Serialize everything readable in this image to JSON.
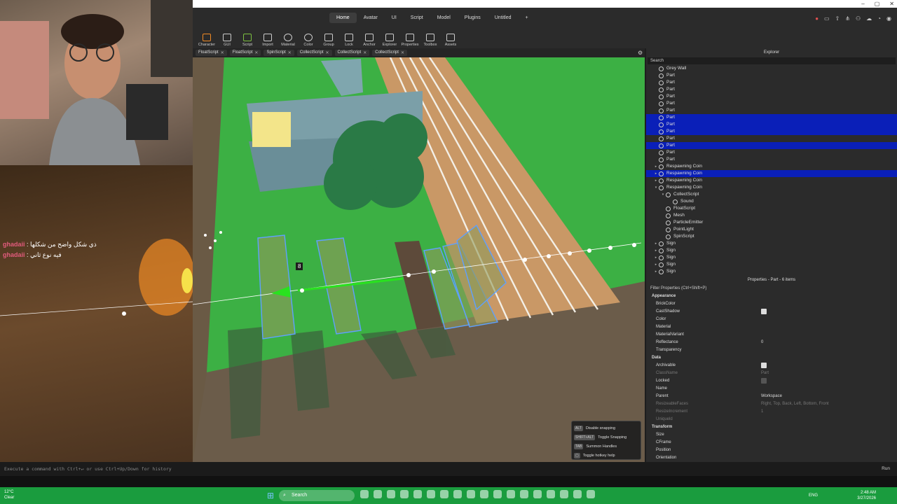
{
  "window": {
    "min": "–",
    "max": "▢",
    "close": "✕"
  },
  "menu": [
    "Home",
    "Avatar",
    "UI",
    "Script",
    "Model",
    "Plugins",
    "Untitled",
    "+"
  ],
  "ribbon": [
    "Character",
    "GUI",
    "Script",
    "Import",
    "Material",
    "Color",
    "Group",
    "Lock",
    "Anchor",
    "Explorer",
    "Properties",
    "Toolbox",
    "Assets"
  ],
  "script_tabs": [
    "FloatScript",
    "FloatScript",
    "SpinScript",
    "CollectScript",
    "CollectScript",
    "CollectScript"
  ],
  "chat": [
    {
      "user": "ghadaii",
      "text": ": ذي شكل واضح من شكلها"
    },
    {
      "user": "ghadaii",
      "text": ": فيه نوع ثاني"
    }
  ],
  "viewport": {
    "marker": "8"
  },
  "explorer": {
    "title": "Explorer",
    "search": "Search",
    "rows": [
      {
        "label": "Grey Wall",
        "indent": 1,
        "sel": false,
        "exp": ""
      },
      {
        "label": "Part",
        "indent": 1,
        "sel": false,
        "exp": ""
      },
      {
        "label": "Part",
        "indent": 1,
        "sel": false,
        "exp": ""
      },
      {
        "label": "Part",
        "indent": 1,
        "sel": false,
        "exp": ""
      },
      {
        "label": "Part",
        "indent": 1,
        "sel": false,
        "exp": ""
      },
      {
        "label": "Part",
        "indent": 1,
        "sel": false,
        "exp": ""
      },
      {
        "label": "Part",
        "indent": 1,
        "sel": false,
        "exp": ""
      },
      {
        "label": "Part",
        "indent": 1,
        "sel": true,
        "exp": ""
      },
      {
        "label": "Part",
        "indent": 1,
        "sel": true,
        "exp": ""
      },
      {
        "label": "Part",
        "indent": 1,
        "sel": true,
        "exp": ""
      },
      {
        "label": "Part",
        "indent": 1,
        "sel": false,
        "exp": ""
      },
      {
        "label": "Part",
        "indent": 1,
        "sel": true,
        "exp": ""
      },
      {
        "label": "Part",
        "indent": 1,
        "sel": false,
        "exp": ""
      },
      {
        "label": "Part",
        "indent": 1,
        "sel": false,
        "exp": ""
      },
      {
        "label": "Respawning Coin",
        "indent": 1,
        "sel": false,
        "exp": "▸"
      },
      {
        "label": "Respawning Coin",
        "indent": 1,
        "sel": true,
        "exp": "▸"
      },
      {
        "label": "Respawning Coin",
        "indent": 1,
        "sel": false,
        "exp": "▸"
      },
      {
        "label": "Respawning Coin",
        "indent": 1,
        "sel": false,
        "exp": "▾"
      },
      {
        "label": "CollectScript",
        "indent": 2,
        "sel": false,
        "exp": "▾"
      },
      {
        "label": "Sound",
        "indent": 3,
        "sel": false,
        "exp": ""
      },
      {
        "label": "FloatScript",
        "indent": 2,
        "sel": false,
        "exp": ""
      },
      {
        "label": "Mesh",
        "indent": 2,
        "sel": false,
        "exp": ""
      },
      {
        "label": "ParticleEmitter",
        "indent": 2,
        "sel": false,
        "exp": ""
      },
      {
        "label": "PointLight",
        "indent": 2,
        "sel": false,
        "exp": ""
      },
      {
        "label": "SpinScript",
        "indent": 2,
        "sel": false,
        "exp": ""
      },
      {
        "label": "Sign",
        "indent": 1,
        "sel": false,
        "exp": "▸"
      },
      {
        "label": "Sign",
        "indent": 1,
        "sel": false,
        "exp": "▸"
      },
      {
        "label": "Sign",
        "indent": 1,
        "sel": false,
        "exp": "▸"
      },
      {
        "label": "Sign",
        "indent": 1,
        "sel": false,
        "exp": "▸"
      },
      {
        "label": "Sign",
        "indent": 1,
        "sel": false,
        "exp": "▸"
      }
    ]
  },
  "properties": {
    "title": "Properties - Part - 6 items",
    "filter": "Filter Properties (Ctrl+Shift+P)",
    "rows": [
      {
        "name": "Appearance",
        "value": "",
        "type": "section"
      },
      {
        "name": "BrickColor",
        "value": "",
        "type": "text"
      },
      {
        "name": "CastShadow",
        "value": "",
        "type": "check"
      },
      {
        "name": "Color",
        "value": "",
        "type": "text"
      },
      {
        "name": "Material",
        "value": "",
        "type": "text"
      },
      {
        "name": "MaterialVariant",
        "value": "",
        "type": "text"
      },
      {
        "name": "Reflectance",
        "value": "0",
        "type": "text"
      },
      {
        "name": "Transparency",
        "value": "",
        "type": "text"
      },
      {
        "name": "Data",
        "value": "",
        "type": "section"
      },
      {
        "name": "Archivable",
        "value": "",
        "type": "check"
      },
      {
        "name": "ClassName",
        "value": "Part",
        "type": "dim"
      },
      {
        "name": "Locked",
        "value": "",
        "type": "checkoff"
      },
      {
        "name": "Name",
        "value": "",
        "type": "text"
      },
      {
        "name": "Parent",
        "value": "Workspace",
        "type": "text"
      },
      {
        "name": "ResizeableFaces",
        "value": "Right, Top, Back, Left, Bottom, Front",
        "type": "dim"
      },
      {
        "name": "ResizeIncrement",
        "value": "1",
        "type": "dim"
      },
      {
        "name": "Uniqueld",
        "value": "",
        "type": "dim"
      },
      {
        "name": "Transform",
        "value": "",
        "type": "section"
      },
      {
        "name": "Size",
        "value": "",
        "type": "text"
      },
      {
        "name": "CFrame",
        "value": "",
        "type": "text"
      },
      {
        "name": "Position",
        "value": "",
        "type": "text"
      },
      {
        "name": "Orientation",
        "value": "",
        "type": "text"
      }
    ]
  },
  "hotkeys": [
    {
      "key": "ALT",
      "label": "Disable snapping"
    },
    {
      "key": "SHIFT+ALT",
      "label": "Toggle Snapping"
    },
    {
      "key": "TAB",
      "label": "Summon Handles"
    },
    {
      "key": "",
      "label": "Toggle hotkey help"
    }
  ],
  "command_bar": {
    "placeholder": "Execute a command with Ctrl+↵ or use Ctrl+Up/Down for history",
    "run": "Run"
  },
  "taskbar": {
    "weather_temp": "12°C",
    "weather_desc": "Clear",
    "search": "Search",
    "lang": "ENG",
    "time": "2:48 AM",
    "date": "3/27/2026"
  }
}
